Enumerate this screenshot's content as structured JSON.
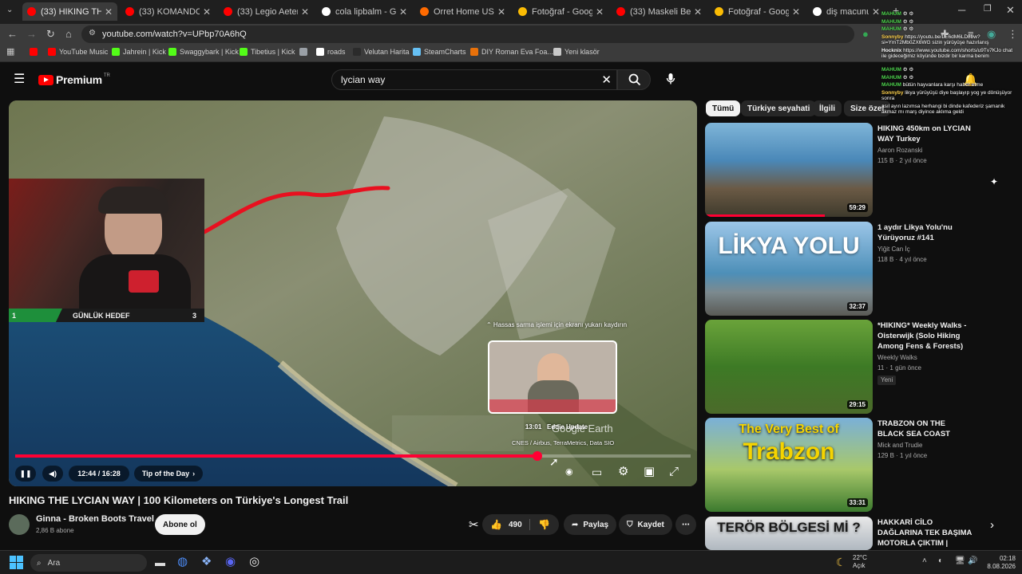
{
  "browser": {
    "tabs": [
      {
        "title": "(33) HIKING THE L",
        "fav": "#ff0000",
        "active": true
      },
      {
        "title": "(33) KOMANDO Marş",
        "fav": "#ff0000"
      },
      {
        "title": "(33) Legio Aeterna Vi",
        "fav": "#ff0000"
      },
      {
        "title": "cola lipbalm - Google",
        "fav": "#ffffff"
      },
      {
        "title": "Orret Home USB Şarj",
        "fav": "#ff6a00"
      },
      {
        "title": "Fotoğraf - Google Fo",
        "fav": "#fbbc04"
      },
      {
        "title": "(33) Maskeli Beşler Fo",
        "fav": "#ff0000"
      },
      {
        "title": "Fotoğraf - Google Fo",
        "fav": "#fbbc04"
      },
      {
        "title": "diş macunu asit mi b",
        "fav": "#ffffff"
      }
    ],
    "url": "youtube.com/watch?v=UPbp70A6hQ",
    "bookmarks": [
      {
        "label": "",
        "color": "#ff0000"
      },
      {
        "label": "YouTube Music",
        "color": "#ff0000"
      },
      {
        "label": "Jahrein | Kick",
        "color": "#53fc18"
      },
      {
        "label": "Swaggybark | Kick",
        "color": "#53fc18"
      },
      {
        "label": "Tibetius | Kick",
        "color": "#53fc18"
      },
      {
        "label": "",
        "color": "#9aa0a6"
      },
      {
        "label": "roads",
        "color": "#ffffff"
      },
      {
        "label": "Velutan Harita",
        "color": "#2b2b2b"
      },
      {
        "label": "SteamCharts",
        "color": "#66c0f4"
      },
      {
        "label": "DIY Roman Eva Foa...",
        "color": "#e8710a"
      },
      {
        "label": "Yeni klasör",
        "color": "#c8c8c8"
      }
    ]
  },
  "youtube": {
    "logo": "Premium",
    "logo_region": "TR",
    "search_value": "lycian way",
    "chips": [
      "Tümü",
      "Türkiye seyahati",
      "İlgili",
      "Size özel"
    ],
    "video": {
      "title": "HIKING THE LYCIAN WAY | 100 Kilometers on Türkiye's Longest Trail",
      "channel": "Ginna - Broken Boots Travel",
      "subs": "2,86 B abone",
      "subscribe": "Abone ol",
      "likes": "490",
      "share": "Paylaş",
      "save": "Kaydet",
      "time": "12:44 / 16:28",
      "chapter": "Tip of the Day",
      "progress": 0.773,
      "earth_logo": "Google Earth",
      "credits": "CNES / Airbus, TerraMetrics, Data SIO",
      "preview_hint": "⌃ Hassas sarma işlemi için ekranı yukarı kaydırın",
      "preview_time": "13:01",
      "preview_label": "Eddie Update"
    },
    "overlay": {
      "left_value": "1",
      "label": "GÜNLÜK HEDEF",
      "right_value": "3"
    },
    "recommended": [
      {
        "title": "HIKING 450km on LYCIAN WAY Turkey",
        "channel": "Aaron Rozanski",
        "meta": "115 B · 2 yıl önce",
        "dur": "59:29"
      },
      {
        "title": "1 aydır Likya Yolu'nu Yürüyoruz #141",
        "channel": "Yiğit Can İç",
        "meta": "118 B · 4 yıl önce",
        "dur": "32:37",
        "thumb_text": "LİKYA YOLU"
      },
      {
        "title": "*HIKING* Weekly Walks - Oisterwijk (Solo Hiking Among Fens & Forests)",
        "channel": "Weekly Walks",
        "meta": "11 · 1 gün önce",
        "badge": "Yeni",
        "dur": "29:15"
      },
      {
        "title": "TRABZON ON THE BLACK SEA COAST",
        "channel": "Mick and Trudie",
        "meta": "129 B · 1 yıl önce",
        "dur": "33:31",
        "thumb_top": "The Very Best of",
        "thumb_big": "Trabzon"
      },
      {
        "title": "HAKKARİ CİLO DAĞLARINA TEK BAŞIMA MOTORLA ÇIKTIM | Köylerden Şırnak'...",
        "thumb_text": "TERÖR BÖLGESİ Mİ ?"
      }
    ]
  },
  "chat_overlay": [
    {
      "user": "MAHUM",
      "text": "⚙ ⚙",
      "color": "#4dd24d"
    },
    {
      "user": "MAHUM",
      "text": "⚙ ⚙",
      "color": "#4dd24d"
    },
    {
      "user": "MAHUM",
      "text": "⚙ ⚙",
      "color": "#4dd24d"
    },
    {
      "user": "Sonnyby",
      "text": "https://youtu.be/LE6dM6LD8bw?si=YmT2Mb0ZX6WG sizin yürüyüşe hazırlanış",
      "color": "#ffd24d"
    },
    {
      "user": "Hocknix",
      "text": "https://www.youtube.com/shorts/u9Tv7KJo chat ile gideceğimiz köyünde bizdir bir karma benim",
      "color": "#ffffff"
    },
    {
      "user": "MAHUM",
      "text": "⚙ ⚙",
      "color": "#4dd24d"
    },
    {
      "user": "MAHUM",
      "text": "⚙ ⚙",
      "color": "#4dd24d"
    },
    {
      "user": "MAHUM",
      "text": "bütün hayvanlara karşı haber etme",
      "color": "#4dd24d"
    },
    {
      "user": "Sonnyby",
      "text": "likya yürüyüşü diye başlayıp yog ye dönüşüyor sonra",
      "color": "#ffd24d"
    },
    {
      "user": "",
      "text": "asıl ayın lazımsa herhangi bi dinde kafederiz şamanik akmaz mı marş diyince aklıma geldi",
      "color": "#ffffff"
    }
  ],
  "taskbar": {
    "search": "Ara",
    "temp": "22°C",
    "weather": "Açık",
    "time": "02:18",
    "date": "8.08.2026"
  }
}
